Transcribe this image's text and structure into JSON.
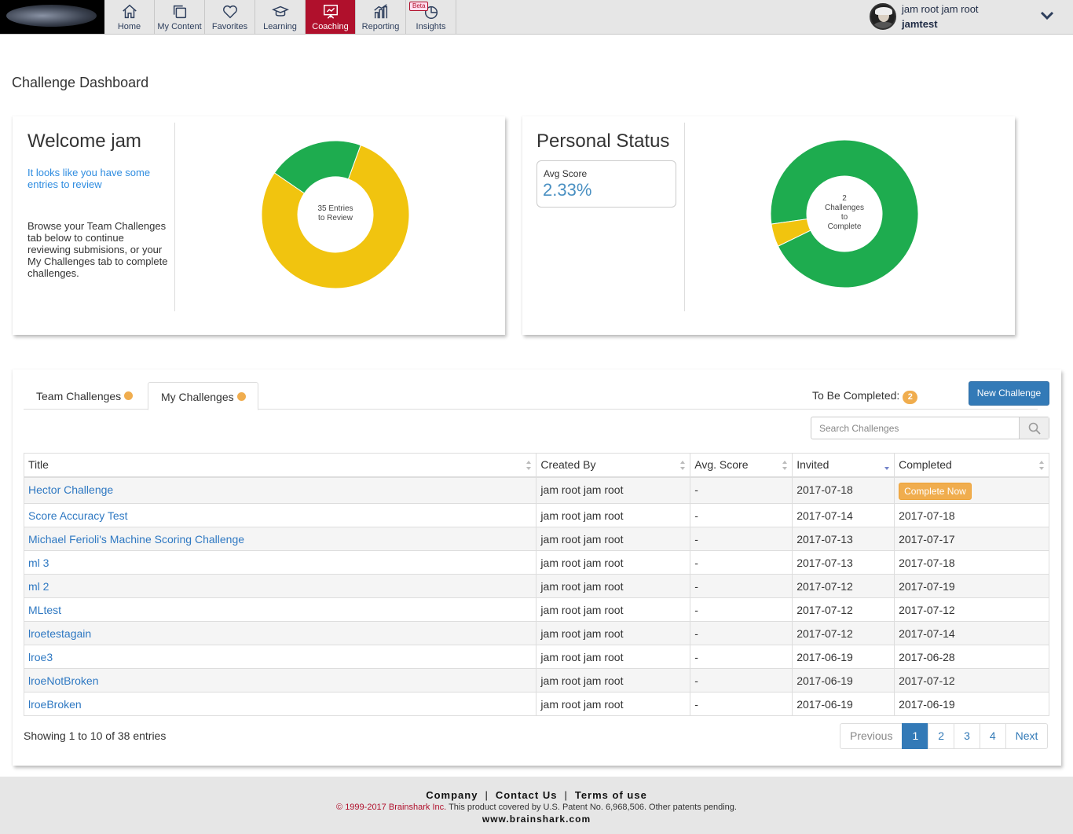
{
  "nav": {
    "items": [
      {
        "label": "Home",
        "icon": "home-icon"
      },
      {
        "label": "My Content",
        "icon": "content-icon"
      },
      {
        "label": "Favorites",
        "icon": "heart-icon"
      },
      {
        "label": "Learning",
        "icon": "graduation-cap-icon"
      },
      {
        "label": "Coaching",
        "icon": "presentation-board-icon",
        "active": true
      },
      {
        "label": "Reporting",
        "icon": "bar-chart-icon"
      },
      {
        "label": "Insights",
        "icon": "pie-chart-icon",
        "badge": "Beta"
      }
    ],
    "accent": "#b0102c"
  },
  "user": {
    "name": "jam root jam root",
    "login": "jamtest"
  },
  "page": {
    "title": "Challenge Dashboard"
  },
  "welcome": {
    "title": "Welcome jam",
    "review_link": "It looks like you have some entries to review",
    "browse_text": "Browse your Team Challenges tab below to continue reviewing submisions, or your My Challenges tab to complete challenges.",
    "donut_center_1": "35 Entries",
    "donut_center_2": "to Review",
    "donut": [
      {
        "name": "yellow",
        "value": 0.79,
        "color": "#f1c40f"
      },
      {
        "name": "green",
        "value": 0.21,
        "color": "#1eac4f"
      }
    ]
  },
  "status": {
    "title": "Personal Status",
    "avg_label": "Avg Score",
    "avg_value": "2.33%",
    "donut_center_1": "2",
    "donut_center_2": "Challenges",
    "donut_center_3": "to",
    "donut_center_4": "Complete",
    "donut": [
      {
        "name": "green",
        "value": 0.95,
        "color": "#1eac4f"
      },
      {
        "name": "yellow",
        "value": 0.05,
        "color": "#f1c40f"
      }
    ]
  },
  "tabs": {
    "team": "Team Challenges",
    "mine": "My Challenges"
  },
  "to_be_completed": {
    "label": "To Be Completed:",
    "count": "2"
  },
  "new_challenge": "New Challenge",
  "search": {
    "placeholder": "Search Challenges"
  },
  "table": {
    "columns": [
      "Title",
      "Created By",
      "Avg. Score",
      "Invited",
      "Completed"
    ],
    "complete_now": "Complete Now",
    "rows": [
      {
        "title": "Hector Challenge",
        "created_by": "jam root jam root",
        "score": "-",
        "invited": "2017-07-18",
        "completed": ""
      },
      {
        "title": "Score Accuracy Test",
        "created_by": "jam root jam root",
        "score": "-",
        "invited": "2017-07-14",
        "completed": "2017-07-18"
      },
      {
        "title": "Michael Ferioli's Machine Scoring Challenge",
        "created_by": "jam root jam root",
        "score": "-",
        "invited": "2017-07-13",
        "completed": "2017-07-17"
      },
      {
        "title": "ml 3",
        "created_by": "jam root jam root",
        "score": "-",
        "invited": "2017-07-13",
        "completed": "2017-07-18"
      },
      {
        "title": "ml 2",
        "created_by": "jam root jam root",
        "score": "-",
        "invited": "2017-07-12",
        "completed": "2017-07-19"
      },
      {
        "title": "MLtest",
        "created_by": "jam root jam root",
        "score": "-",
        "invited": "2017-07-12",
        "completed": "2017-07-12"
      },
      {
        "title": "lroetestagain",
        "created_by": "jam root jam root",
        "score": "-",
        "invited": "2017-07-12",
        "completed": "2017-07-14"
      },
      {
        "title": "lroe3",
        "created_by": "jam root jam root",
        "score": "-",
        "invited": "2017-06-19",
        "completed": "2017-06-28"
      },
      {
        "title": "lroeNotBroken",
        "created_by": "jam root jam root",
        "score": "-",
        "invited": "2017-06-19",
        "completed": "2017-07-12"
      },
      {
        "title": "lroeBroken",
        "created_by": "jam root jam root",
        "score": "-",
        "invited": "2017-06-19",
        "completed": "2017-06-19"
      }
    ]
  },
  "showing": "Showing 1 to 10 of 38 entries",
  "pagination": {
    "previous": "Previous",
    "pages": [
      "1",
      "2",
      "3",
      "4"
    ],
    "next": "Next",
    "current": "1"
  },
  "footer": {
    "links": [
      "Company",
      "Contact Us",
      "Terms of use"
    ],
    "sep": "|",
    "copyright_brand": "© 1999-2017 Brainshark Inc.",
    "copyright_rest": " This product covered by U.S. Patent No. 6,968,506. Other patents pending.",
    "url": "www.brainshark.com"
  }
}
